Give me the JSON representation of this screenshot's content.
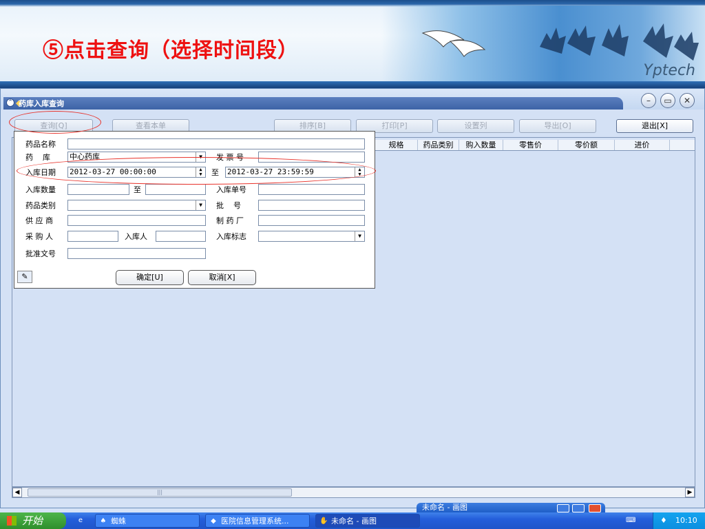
{
  "banner": {
    "caption": "⑤点击查询（选择时间段）",
    "brand": "Yptech"
  },
  "window": {
    "title": "药库入库查询",
    "controls": {
      "minimize": "–",
      "restore": "▭",
      "close": "✕"
    }
  },
  "toolbar": {
    "query": "查询[Q]",
    "view_bill": "查看本单",
    "sort": "排序[B]",
    "print": "打印[P]",
    "set_columns": "设置列",
    "export": "导出[O]",
    "exit": "退出[X]"
  },
  "grid": {
    "columns": [
      "规格",
      "药品类别",
      "购入数量",
      "零售价",
      "零价额",
      "进价"
    ]
  },
  "dialog": {
    "drug_name_label": "药品名称",
    "warehouse_label": "药    库",
    "warehouse_value": "中心药库",
    "invoice_label": "发 票 号",
    "date_label": "入库日期",
    "date_from": "2012-03-27 00:00:00",
    "to_label": "至",
    "date_to": "2012-03-27 23:59:59",
    "qty_label": "入库数量",
    "qty_to_label": "至",
    "bill_no_label": "入库单号",
    "category_label": "药品类别",
    "batch_label": "批    号",
    "supplier_label": "供 应 商",
    "manufacturer_label": "制 药 厂",
    "purchaser_label": "采 购 人",
    "receiver_label": "入库人",
    "flag_label": "入库标志",
    "approval_label": "批准文号",
    "ok": "确定[U]",
    "cancel": "取消[X]"
  },
  "background_window": {
    "title": "未命名 - 画图"
  },
  "taskbar": {
    "start": "开始",
    "tasks": [
      "蜘蛛",
      "医院信息管理系统...",
      "未命名 - 画图"
    ],
    "clock": "10:10"
  }
}
